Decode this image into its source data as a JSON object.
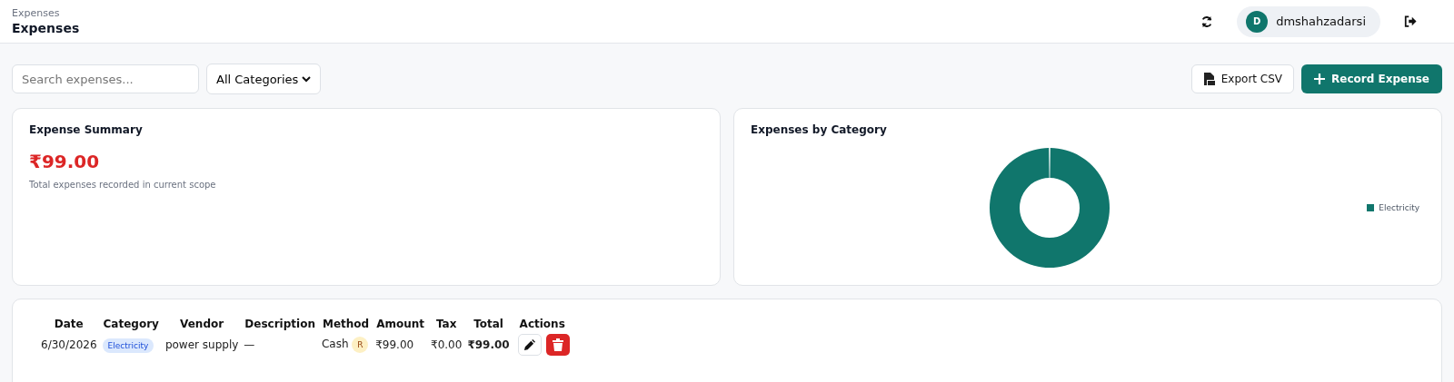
{
  "header": {
    "breadcrumb": "Expenses",
    "title": "Expenses",
    "user": {
      "initial": "D",
      "name": "dmshahzadarsi"
    }
  },
  "toolbar": {
    "search": {
      "placeholder": "Search expenses..."
    },
    "category_filter": "All Categories",
    "export_button": "Export CSV",
    "record_button": "Record Expense"
  },
  "summary": {
    "title": "Expense Summary",
    "total": "₹99.00",
    "caption": "Total expenses recorded in current scope"
  },
  "category_chart": {
    "title": "Expenses by Category",
    "legend": [
      {
        "label": "Electricity",
        "color": "#10766c"
      }
    ]
  },
  "table": {
    "columns": [
      "Date",
      "Category",
      "Vendor",
      "Description",
      "Method",
      "Amount",
      "Tax",
      "Total",
      "Actions"
    ],
    "rows": [
      {
        "date": "6/30/2026",
        "category": "Electricity",
        "vendor": "power supply",
        "description": "—",
        "method": "Cash",
        "method_badge": "R",
        "amount": "₹99.00",
        "tax": "₹0.00",
        "total": "₹99.00"
      }
    ]
  }
}
